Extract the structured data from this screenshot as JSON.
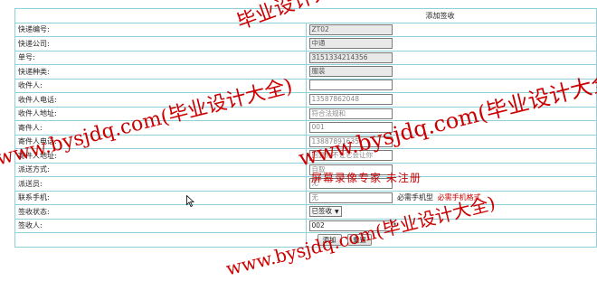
{
  "form": {
    "title": "添加签收",
    "rows": [
      {
        "label": "快递编号:",
        "value": "ZT02"
      },
      {
        "label": "快递公司:",
        "value": "中通"
      },
      {
        "label": "单号:",
        "value": "3151334214356"
      },
      {
        "label": "快递种类:",
        "value": "服装"
      },
      {
        "label": "收件人:",
        "value": ""
      },
      {
        "label": "收件人电话:",
        "value": "13587862048"
      },
      {
        "label": "收件人地址:",
        "value": "符合法规和"
      },
      {
        "label": "寄件人:",
        "value": "001"
      },
      {
        "label": "寄件人电话:",
        "value": "13887891635"
      },
      {
        "label": "寄件人地址:",
        "value": "回复你不让它会让你"
      },
      {
        "label": "派送方式:",
        "value": "自取"
      },
      {
        "label": "派送员:",
        "value": "无"
      }
    ],
    "contact": {
      "label": "联系手机:",
      "value": "无",
      "hint": "必需手机型",
      "hint_red": "必需手机格式"
    },
    "status": {
      "label": "签收状态:",
      "value": "已签收"
    },
    "signer": {
      "label": "签收人:",
      "value": "002",
      "required": "*"
    },
    "buttons": {
      "add": "添加",
      "reset": "重置"
    }
  },
  "watermark": {
    "lines": [
      "毕业设计大全",
      "www.bysjdq.com(毕业设计大全)",
      "www.bysjdq.com(毕业设计大全)",
      "www.bysjdq.com(毕业设计大全)"
    ],
    "registration": "屏幕录像专家 未注册",
    "color": "#cc0000"
  },
  "colors": {
    "grid": "#8fd0dc",
    "readonly_bg": "#e9e9e9"
  }
}
